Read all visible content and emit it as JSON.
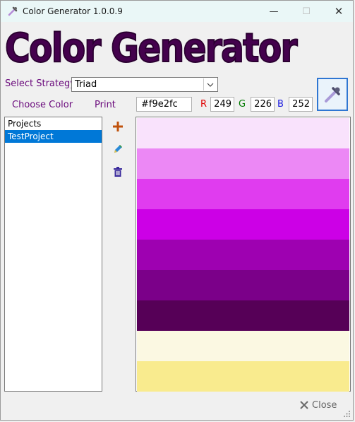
{
  "window": {
    "title": "Color Generator 1.0.0.9",
    "icon": "eyedropper-icon",
    "minimize_glyph": "—",
    "maximize_glyph": "☐",
    "close_glyph": "✕"
  },
  "app_title": "Color Generator",
  "strategy": {
    "label": "Select Strategy",
    "selected": "Triad",
    "dropdown_icon": "chevron-down-icon"
  },
  "choose_color_label": "Choose Color",
  "print_label": "Print",
  "current_color": {
    "hex": "#f9e2fc",
    "r_label": "R",
    "g_label": "G",
    "b_label": "B",
    "r": "249",
    "g": "226",
    "b": "252"
  },
  "projects": {
    "items": [
      {
        "label": "Projects",
        "selected": false
      },
      {
        "label": "TestProject",
        "selected": true
      }
    ]
  },
  "tools": {
    "add_icon": "plus-icon",
    "edit_icon": "pencil-icon",
    "delete_icon": "trash-icon"
  },
  "palette": {
    "colors": [
      "#f9e2fc",
      "#ec88f5",
      "#e03cef",
      "#cc00e6",
      "#9e01b1",
      "#7b0089",
      "#560057",
      "#fbf8e2",
      "#f9eb8e"
    ]
  },
  "close_button": {
    "label": "Close",
    "icon": "close-icon"
  },
  "accent": {
    "title_purple": "#44014d",
    "label_purple": "#6a0a7c",
    "selection_blue": "#0078d7"
  }
}
